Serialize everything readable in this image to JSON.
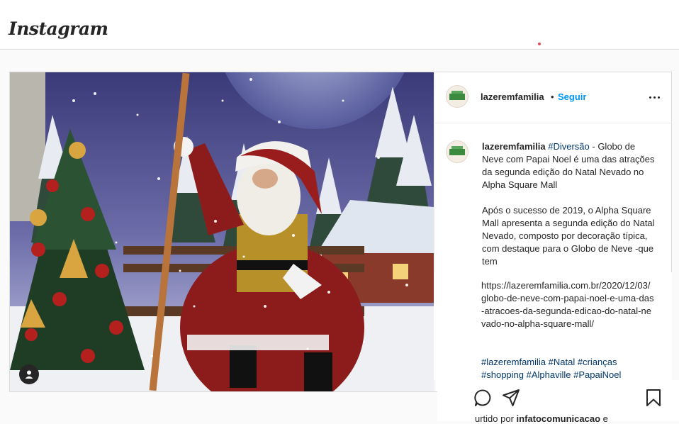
{
  "app": {
    "logo": "Instagram"
  },
  "post": {
    "username": "lazeremfamilia",
    "dot": "•",
    "follow_label": "Seguir",
    "caption": {
      "username": "lazeremfamilia",
      "first_hashtag": "#Diversão",
      "intro": " - Globo de Neve com Papai Noel é uma das atrações da segunda edição do Natal Nevado no Alpha Square Mall",
      "paragraph2": "Após o sucesso de 2019, o Alpha Square Mall apresenta a segunda edição do Natal Nevado, composto por decoração típica, com destaque para o Globo de Neve -que tem",
      "link": "https://lazeremfamilia.com.br/2020/12/03/globo-de-neve-com-papai-noel-e-uma-das-atracoes-da-segunda-edicao-do-natal-nevado-no-alpha-square-mall/",
      "hashtags": [
        "#lazeremfamilia",
        "#Natal",
        "#crianças",
        "#shopping",
        "#Alphaville",
        "#PapaiNoel"
      ]
    },
    "liked_by": "urtido por ",
    "liked_user": "infatocomunicacao",
    "liked_tail": " e"
  },
  "icons": {
    "more": "more-options-icon",
    "comment": "comment-icon",
    "share": "share-icon",
    "save": "bookmark-icon",
    "user_tag": "user-tag-icon"
  }
}
